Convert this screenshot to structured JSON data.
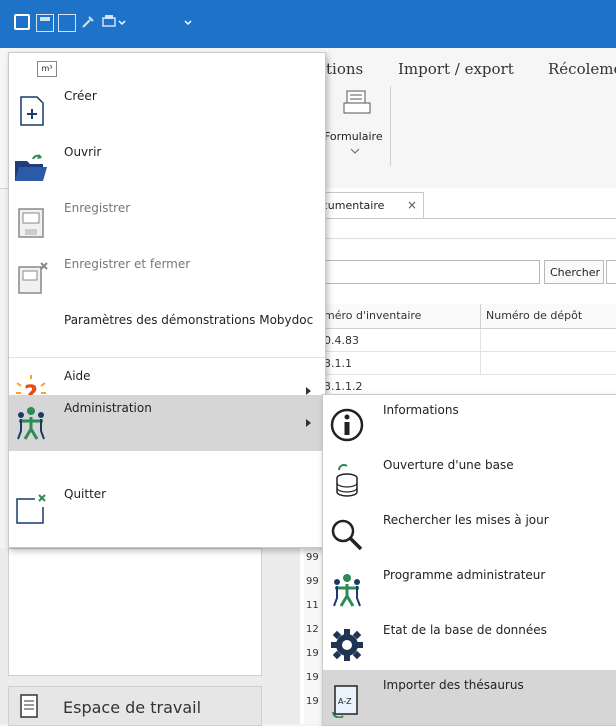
{
  "ribbon": {
    "tabs": [
      "tions",
      "Import / export",
      "Récoleme"
    ],
    "formulaire_label": "Formulaire"
  },
  "doc": {
    "tab_label": "ocumentaire",
    "tab_close": "×",
    "search_button": "Chercher",
    "columns": [
      "méro d'inventaire",
      "Numéro de dépôt"
    ],
    "rows": [
      "0.4.83",
      "3.1.1",
      "3.1.1.2"
    ],
    "row_stubs": [
      "99",
      "99",
      "11",
      "12",
      "19",
      "19",
      "19"
    ]
  },
  "left_pane": {
    "workspace_label": "Espace de travail"
  },
  "menu": {
    "header_logo": "m³",
    "items": [
      {
        "label": "Créer",
        "icon": "new-document-icon"
      },
      {
        "label": "Ouvrir",
        "icon": "open-folder-icon"
      },
      {
        "label": "Enregistrer",
        "icon": "save-icon"
      },
      {
        "label": "Enregistrer et fermer",
        "icon": "save-close-icon"
      },
      {
        "label": "Paramètres des démonstrations Mobydoc",
        "icon": ""
      },
      {
        "label": "Aide",
        "icon": "help-icon"
      },
      {
        "label": "Administration",
        "icon": "admin-people-icon"
      },
      {
        "label": "Quitter",
        "icon": "exit-icon"
      }
    ]
  },
  "submenu": {
    "items": [
      {
        "label": "Informations",
        "icon": "info-icon"
      },
      {
        "label": "Ouverture d'une base",
        "icon": "database-open-icon"
      },
      {
        "label": "Rechercher les mises à jour",
        "icon": "magnifier-icon"
      },
      {
        "label": "Programme administrateur",
        "icon": "admin-people-icon"
      },
      {
        "label": "Etat de la base de données",
        "icon": "gear-icon"
      },
      {
        "label": "Importer des thésaurus",
        "icon": "thesaurus-import-icon"
      }
    ]
  },
  "colors": {
    "titlebar": "#1e73c8",
    "highlight": "#d6d6d6",
    "accent_green": "#2e8b57"
  }
}
